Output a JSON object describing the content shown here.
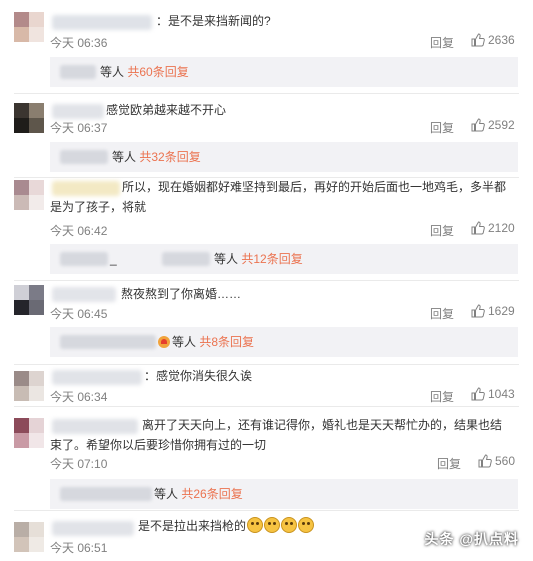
{
  "comments": [
    {
      "text": "：是不是来挡新闻的?",
      "time": "今天 06:36",
      "reply_label": "回复",
      "likes": "2636",
      "sub_replies": {
        "suffix": "等人",
        "link": "共60条回复"
      }
    },
    {
      "text": "感觉欧弟越来越不开心",
      "time": "今天 06:37",
      "reply_label": "回复",
      "likes": "2592",
      "sub_replies": {
        "suffix": "等人",
        "link": "共32条回复"
      }
    },
    {
      "text": "所以，现在婚姻都好难坚持到最后，再好的开始后面也一地鸡毛，多半都是为了孩子，将就",
      "time": "今天 06:42",
      "reply_label": "回复",
      "likes": "2120",
      "sub_replies": {
        "prefix": "_",
        "suffix": "等人",
        "link": "共12条回复"
      }
    },
    {
      "text": "熬夜熬到了你离婚……",
      "time": "今天 06:45",
      "reply_label": "回复",
      "likes": "1629",
      "sub_replies": {
        "suffix": "等人",
        "link": "共8条回复"
      }
    },
    {
      "text": "：感觉你消失很久诶",
      "time": "今天 06:34",
      "reply_label": "回复",
      "likes": "1043"
    },
    {
      "text": "离开了天天向上，还有谁记得你，婚礼也是天天帮忙办的，结果也结束了。希望你以后要珍惜你拥有过的一切",
      "time": "今天 07:10",
      "reply_label": "回复",
      "likes": "560",
      "sub_replies": {
        "suffix": "等人",
        "link": "共26条回复"
      }
    },
    {
      "text": "是不是拉出来挡枪的",
      "time": "今天 06:51"
    }
  ],
  "watermark": "头条 @扒点料",
  "icons": {
    "like": "thumbs-up-icon"
  },
  "colors": {
    "link": "#eb7350",
    "meta": "#808080",
    "sub_bg": "#f2f2f5"
  }
}
